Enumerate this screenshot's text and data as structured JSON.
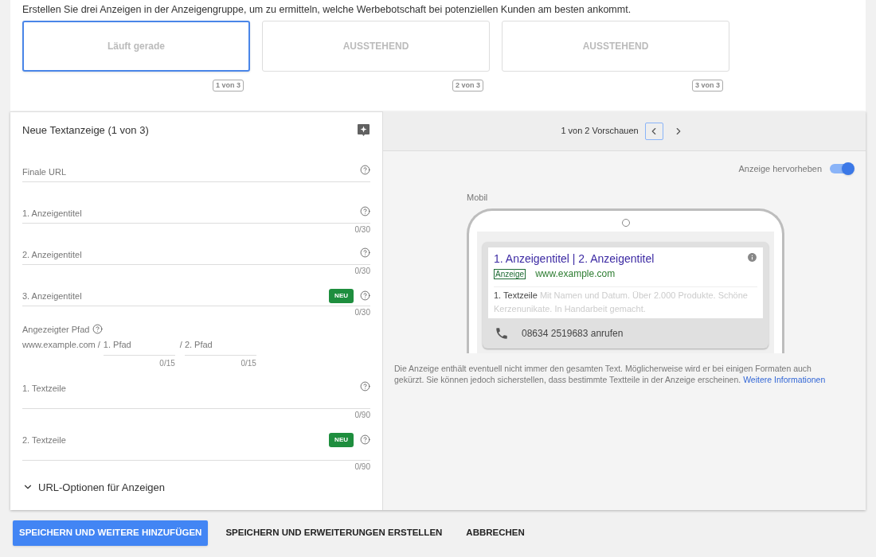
{
  "intro": "Erstellen Sie drei Anzeigen in der Anzeigengruppe, um zu ermitteln, welche Werbebotschaft bei potenziellen Kunden am besten ankommt.",
  "steps": [
    {
      "label": "Läuft gerade",
      "counter": "1 von 3",
      "selected": true
    },
    {
      "label": "AUSSTEHEND",
      "counter": "2 von 3",
      "selected": false
    },
    {
      "label": "AUSSTEHEND",
      "counter": "3 von 3",
      "selected": false
    }
  ],
  "form": {
    "title": "Neue Textanzeige (1 von 3)",
    "fields": [
      {
        "kind": "input",
        "label": "Finale URL",
        "neu": false
      },
      {
        "kind": "input",
        "label": "1. Anzeigentitel",
        "counter": "0/30",
        "neu": false
      },
      {
        "kind": "input",
        "label": "2. Anzeigentitel",
        "counter": "0/30",
        "neu": false
      },
      {
        "kind": "input",
        "label": "3. Anzeigentitel",
        "counter": "0/30",
        "neu": true,
        "badge": "NEU"
      },
      {
        "kind": "path",
        "label": "Angezeigter Pfad",
        "domain": "www.example.com /",
        "path1": "1. Pfad",
        "sep": "/",
        "path2": "2. Pfad",
        "counter1": "0/15",
        "counter2": "0/15"
      },
      {
        "kind": "textarea",
        "label": "1. Textzeile",
        "counter": "0/90",
        "neu": false
      },
      {
        "kind": "textarea",
        "label": "2. Textzeile",
        "counter": "0/90",
        "neu": true,
        "badge": "NEU"
      }
    ],
    "expander": {
      "label": "URL-Optionen für Anzeigen",
      "expanded": false
    }
  },
  "preview": {
    "pager": "1 von 2 Vorschauen",
    "toggle": {
      "label": "Anzeige hervorheben",
      "on": true
    },
    "device": "Mobil",
    "ad": {
      "headline": "1. Anzeigentitel | 2. Anzeigentitel",
      "badge": "Anzeige",
      "url": "www.example.com",
      "desc_lead": "1. Textzeile",
      "desc_rest": "Mit Namen und Datum. Über 2.000 Produkte. Schöne Kerzenunikate. In Handarbeit gemacht.",
      "call": "08634 2519683 anrufen"
    },
    "disclaimer": "Die Anzeige enthält eventuell nicht immer den gesamten Text. Möglicherweise wird er bei einigen Formaten auch gekürzt. Sie können jedoch sicherstellen, dass bestimmte Textteile in der Anzeige erscheinen.",
    "link": "Weitere Informationen"
  },
  "actions": [
    {
      "label": "SPEICHERN UND WEITERE HINZUFÜGEN",
      "primary": true
    },
    {
      "label": "SPEICHERN UND ERWEITERUNGEN ERSTELLEN",
      "primary": false
    },
    {
      "label": "ABBRECHEN",
      "primary": false
    }
  ]
}
